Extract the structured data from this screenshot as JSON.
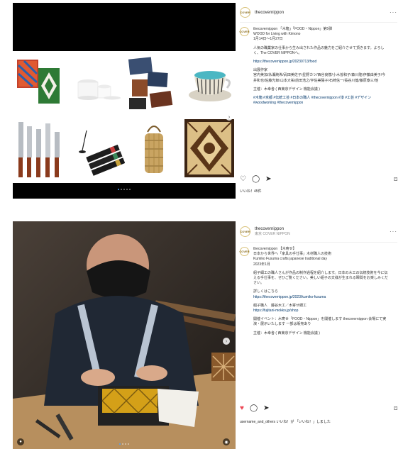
{
  "post1": {
    "header": {
      "account": "thecovernippon",
      "more_icon": "more-dots-icon"
    },
    "avatar_text": "COVER",
    "caption": {
      "author_line": "thecovernippon 「木箱」「FOOD・Nippon」第5弾",
      "line2": "WOOD for Living with Kimono",
      "line3": "1月14日〜1月27日",
      "para1": "人気の職業家の仕事から生み出された作品の魅力をご紹介させて頂きます。よろしく、The COVER NIPPONへ。",
      "link1": "https://thecovernippon.jp/20230713/food",
      "para2_head": "出展作家",
      "para2": "宮内美加/永瀬純希/武田美佐子/星野カツ/西谷良樹/小木曽和子/森川隆/伊藤由美子/今井和也/佐藤光郎/山本大祐/前田浩之/宇佐美陽子/石崎信一/長谷川健/藤原泰三/他",
      "para3": "主催：木幸舎 ( 西東京デザイン 機能会議 )",
      "hashtags": "#木箱 #京都 #伝統工芸 #日本の職人 #thecovernippon #漆 #工芸 #デザイン #woodworking #thecovernippon"
    },
    "likes": "いいね！45件"
  },
  "post2": {
    "header": {
      "account": "thecovernippon",
      "sub": "東京 COVER NIPPON",
      "more_icon": "more-dots-icon"
    },
    "avatar_text": "COVER",
    "caption": {
      "author_line": "thecovernippon 【木寄せ】",
      "line2": "日本から世界へ「家具の手仕事」木材職人の技術",
      "line3": "Kumiko Fusuma crafts japanese traditional day",
      "line4": "2023年1月",
      "para1": "組子細工の職人さんが作品の制作過程を紹介します。日本の木工の伝統技術を今に伝える手仕事を、ぜひご覧ください。美しい組子の文様が生まれる瞬間をお楽しみください。",
      "para2_head": "詳しくはこちら",
      "link1": "https://thecovernippon.jp/2023/kumiko-fusuma",
      "para3_head": "組子職人　藤谷木工／木寄せ細工",
      "link2": "https://fujitani-mokko.jp/shop",
      "para4": "開催イベント：木寄せ「FOOD・Nippon」を開催します thecovernippon 会場にて実演・展示いたします 一部は販売あり",
      "para5": "主催：木幸舎 ( 西東京デザイン 機能会議 )"
    },
    "likes": "username_and_others いいね！が 「いいね！」しました"
  }
}
